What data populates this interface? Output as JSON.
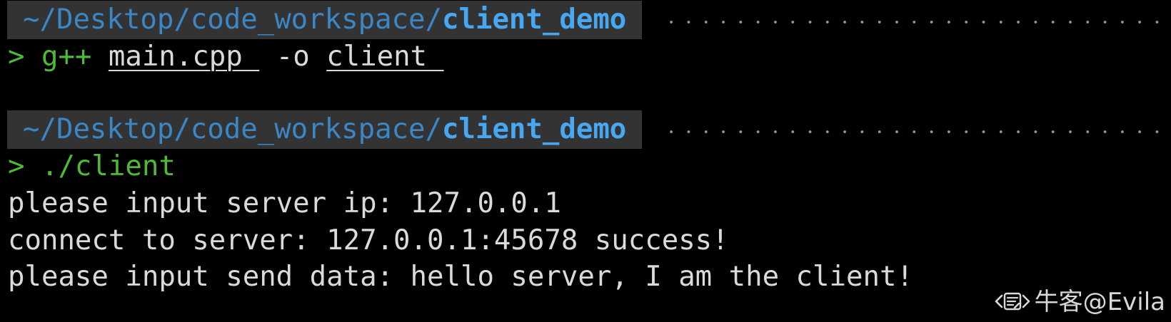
{
  "prompts": [
    {
      "path_prefix": "~/Desktop/code_workspace/",
      "path_current": "client_demo",
      "chevron": ">",
      "command": [
        {
          "text": "g++",
          "style": "cmd"
        },
        {
          "text": " "
        },
        {
          "text": "main.cpp ",
          "style": "arg"
        },
        {
          "text": " -o "
        },
        {
          "text": "client ",
          "style": "arg"
        }
      ]
    },
    {
      "path_prefix": "~/Desktop/code_workspace/",
      "path_current": "client_demo",
      "chevron": ">",
      "command": [
        {
          "text": "./client",
          "style": "cmd"
        }
      ]
    }
  ],
  "output_lines": [
    "please input server ip: 127.0.0.1",
    "connect to server: 127.0.0.1:45678 success!",
    "please input send data: hello server, I am the client!"
  ],
  "watermark": {
    "icon": "niuke-logo-icon",
    "text": "牛客@Evila"
  },
  "colors": {
    "background": "#000000",
    "text": "#dadada",
    "prompt_chevron": "#4eba37",
    "path_prefix": "#3b86c4",
    "path_current": "#47a7f0",
    "path_background": "#333333"
  }
}
